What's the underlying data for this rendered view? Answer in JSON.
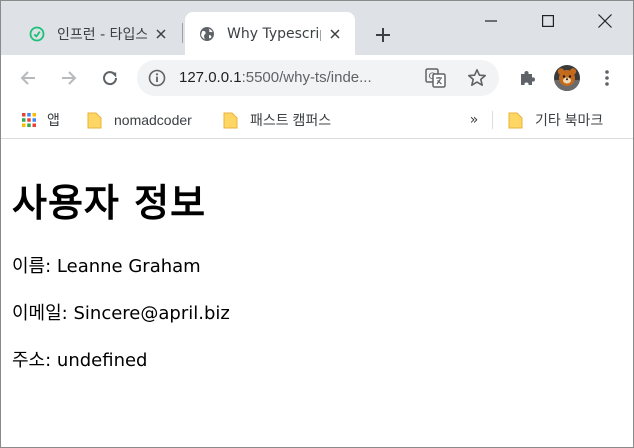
{
  "tabs": [
    {
      "title": "인프런 - 타입스크립트",
      "icon": "inflearn-icon",
      "active": false
    },
    {
      "title": "Why Typescript",
      "icon": "globe-icon",
      "active": true
    }
  ],
  "toolbar": {
    "url_host": "127.0.0.1",
    "url_rest": ":5500/why-ts/inde..."
  },
  "bookmarks": {
    "apps_label": "앱",
    "items": [
      {
        "label": "nomadcoder"
      },
      {
        "label": "패스트 캠퍼스"
      }
    ],
    "more_label": "»",
    "other_label": "기타 북마크"
  },
  "page": {
    "heading": "사용자 정보",
    "rows": [
      {
        "label": "이름:",
        "value": "Leanne Graham"
      },
      {
        "label": "이메일:",
        "value": "Sincere@april.biz"
      },
      {
        "label": "주소:",
        "value": "undefined"
      }
    ]
  },
  "colors": {
    "tabstrip_bg": "#dee1e6",
    "omnibox_bg": "#f1f3f4",
    "folder_yellow": "#fdd663",
    "inflearn_green": "#1dc078"
  }
}
